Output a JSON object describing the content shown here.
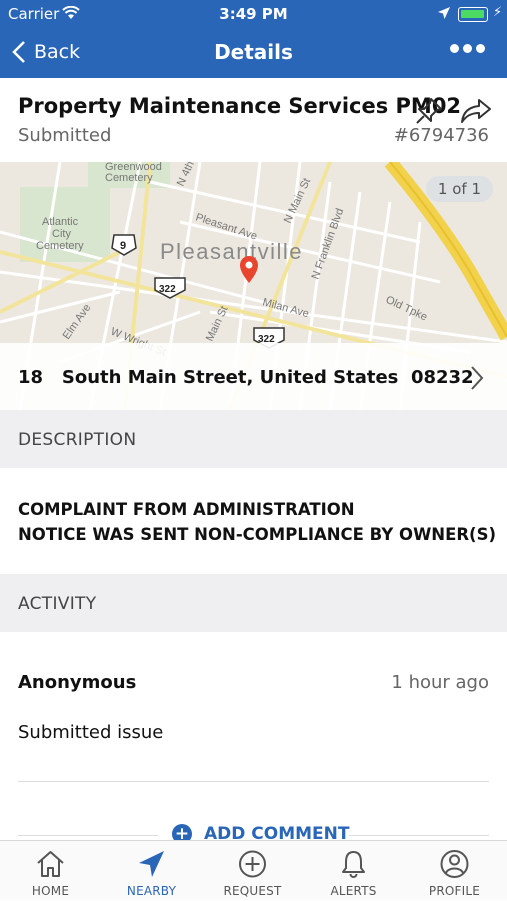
{
  "status_bar": {
    "carrier": "Carrier",
    "time": "3:49 PM"
  },
  "nav": {
    "back_label": "Back",
    "title": "Details"
  },
  "request": {
    "title": "Property Maintenance Services PM02",
    "status": "Submitted",
    "number": "#6794736"
  },
  "map": {
    "pager": "1 of 1",
    "town_label": "Pleasantville",
    "labels": [
      "Greenwood Cemetery",
      "Atlantic City Cemetery",
      "N Main St",
      "Pleasant Ave",
      "N Franklin Blvd",
      "Milan Ave",
      "Old Tpke",
      "Elm Ave",
      "W Wright St",
      "Main St",
      "N 4th",
      "9",
      "322"
    ]
  },
  "address": {
    "number": "18",
    "street": "South Main Street, United States",
    "zip": "08232"
  },
  "description": {
    "header": "DESCRIPTION",
    "line1": "COMPLAINT FROM ADMINISTRATION",
    "line2": "NOTICE WAS SENT NON-COMPLIANCE BY OWNER(S)"
  },
  "activity": {
    "header": "ACTIVITY",
    "author": "Anonymous",
    "time_ago": "1 hour ago",
    "message": "Submitted issue",
    "add_comment_label": "ADD COMMENT"
  },
  "tabs": [
    {
      "label": "HOME",
      "icon": "home-icon",
      "active": false
    },
    {
      "label": "NEARBY",
      "icon": "navigation-arrow-icon",
      "active": true
    },
    {
      "label": "REQUEST",
      "icon": "plus-circle-icon",
      "active": false
    },
    {
      "label": "ALERTS",
      "icon": "bell-icon",
      "active": false
    },
    {
      "label": "PROFILE",
      "icon": "user-circle-icon",
      "active": false
    }
  ],
  "colors": {
    "brand_blue": "#2a66b7",
    "section_bg": "#efeff1",
    "map_pin": "#e8452f",
    "highway_yellow": "#f2d14b"
  }
}
